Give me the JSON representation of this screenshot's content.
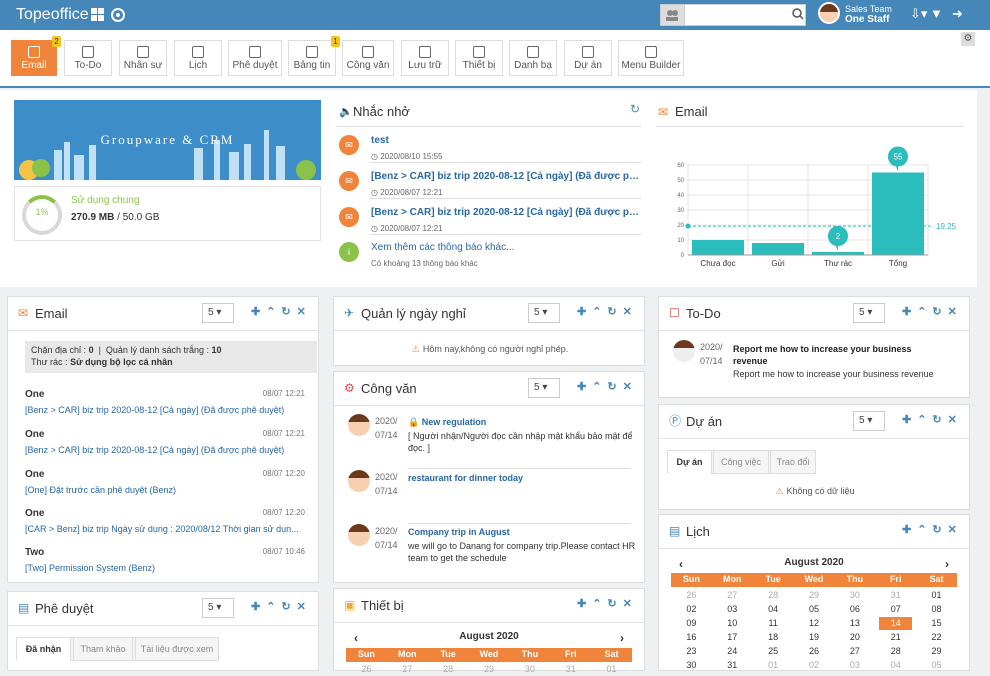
{
  "app": {
    "title": "Topeoffice"
  },
  "header": {
    "user_team": "Sales Team",
    "user_name": "One Staff",
    "search_placeholder": ""
  },
  "toolbar": {
    "modules": [
      {
        "label": "Email",
        "badge": "2",
        "active": true
      },
      {
        "label": "To-Do"
      },
      {
        "label": "Nhân sự"
      },
      {
        "label": "Lịch"
      },
      {
        "label": "Phê duyệt"
      },
      {
        "label": "Bảng tin",
        "badge": "1"
      },
      {
        "label": "Công văn"
      },
      {
        "label": "Lưu trữ"
      },
      {
        "label": "Thiết bị"
      },
      {
        "label": "Danh bạ"
      },
      {
        "label": "Dự án"
      },
      {
        "label": "Menu Builder"
      }
    ]
  },
  "banner": {
    "text": "Groupware & CRM"
  },
  "usage": {
    "title": "Sử dụng chung",
    "percent": "1%",
    "value": "270.9 MB",
    "total": "50.0 GB"
  },
  "reminders": {
    "title": "Nhắc nhở",
    "items": [
      {
        "title": "test",
        "date": "2020/08/10 15:55"
      },
      {
        "title": "[Benz > CAR] biz trip 2020-08-12 [Cả ngày] (Đã được phê...",
        "date": "2020/08/07 12:21"
      },
      {
        "title": "[Benz > CAR] biz trip 2020-08-12 [Cả ngày] (Đã được phê...",
        "date": "2020/08/07 12:21"
      }
    ],
    "more": "Xem thêm các thông báo khác...",
    "more_count": "Có khoảng 13 thông báo khác"
  },
  "email_chart": {
    "title": "Email"
  },
  "chart_data": {
    "type": "bar",
    "categories": [
      "Chưa đọc",
      "Gửi",
      "Thư rác",
      "Tổng"
    ],
    "values": [
      10,
      8,
      2,
      55
    ],
    "avg_line": 19.25,
    "avg_label": "19.25",
    "callouts": [
      {
        "category": "Thư rác",
        "label": "2"
      },
      {
        "category": "Tổng",
        "label": "55"
      }
    ],
    "ylim": [
      0,
      60
    ],
    "yticks": [
      "0",
      "10",
      "20",
      "30",
      "40",
      "50",
      "60"
    ],
    "colors": {
      "bar": "#2bbcbc",
      "line": "#2bbcbc"
    }
  },
  "email_panel": {
    "title": "Email",
    "page_size": "5",
    "filter": {
      "line1_a": "Chặn địa chỉ :",
      "line1_a_val": "0",
      "line1_b": "Quản lý danh sách trắng :",
      "line1_b_val": "10",
      "line2": "Thư rác :",
      "line2_val": "Sử dụng bộ lọc cá nhân"
    },
    "rows": [
      {
        "sender": "One",
        "time": "08/07 12:21",
        "subject": "[Benz > CAR] biz trip 2020-08-12 [Cả ngày] (Đã được phê duyệt)"
      },
      {
        "sender": "One",
        "time": "08/07 12:21",
        "subject": "[Benz > CAR] biz trip 2020-08-12 [Cả ngày] (Đã được phê duyệt)"
      },
      {
        "sender": "One",
        "time": "08/07 12:20",
        "subject": "[One] Đặt trước cần phê duyệt (Benz)"
      },
      {
        "sender": "One",
        "time": "08/07 12:20",
        "subject": "[CAR > Benz] biz trip Ngày sử dụng : 2020/08/12 Thời gian sử dụn..."
      },
      {
        "sender": "Two",
        "time": "08/07 10:46",
        "subject": "[Two] Permission System (Benz)"
      }
    ]
  },
  "approval_panel": {
    "title": "Phê duyệt",
    "page_size": "5",
    "tabs": [
      "Đã nhận",
      "Tham khảo",
      "Tài liệu được xem"
    ]
  },
  "leave_panel": {
    "title": "Quản lý ngày nghỉ",
    "page_size": "5",
    "empty": "Hôm nay,không có người nghỉ phép."
  },
  "doc_panel": {
    "title": "Công văn",
    "page_size": "5",
    "rows": [
      {
        "year": "2020/",
        "day": "07/14",
        "title": "New regulation",
        "body": "[ Người nhận/Người đọc cần nhập mật khẩu bảo mật để đọc. ]",
        "locked": true
      },
      {
        "year": "2020/",
        "day": "07/14",
        "title": "restaurant for dinner today",
        "body": ""
      },
      {
        "year": "2020/",
        "day": "07/14",
        "title": "Company trip in August",
        "body": "we will go to Danang for company trip.Please contact HR team to get the schedule"
      }
    ]
  },
  "device_panel": {
    "title": "Thiết bị",
    "month": "August 2020",
    "days": [
      "Sun",
      "Mon",
      "Tue",
      "Wed",
      "Thu",
      "Fri",
      "Sat"
    ],
    "first_row": [
      "26",
      "27",
      "28",
      "29",
      "30",
      "31",
      "01"
    ]
  },
  "todo_panel": {
    "title": "To-Do",
    "page_size": "5",
    "item": {
      "year": "2020/",
      "day": "07/14",
      "title": "Report me how to increase your business revenue",
      "body": "Report me how to increase your business revenue"
    }
  },
  "project_panel": {
    "title": "Dự án",
    "page_size": "5",
    "tabs": [
      "Dự án",
      "Công việc",
      "Trao đổi"
    ],
    "empty": "Không có dữ liệu"
  },
  "calendar_panel": {
    "title": "Lịch",
    "month": "August 2020",
    "days": [
      "Sun",
      "Mon",
      "Tue",
      "Wed",
      "Thu",
      "Fri",
      "Sat"
    ],
    "weeks": [
      [
        "26",
        "27",
        "28",
        "29",
        "30",
        "31",
        "01"
      ],
      [
        "02",
        "03",
        "04",
        "05",
        "06",
        "07",
        "08"
      ],
      [
        "09",
        "10",
        "11",
        "12",
        "13",
        "14",
        "15"
      ],
      [
        "16",
        "17",
        "18",
        "19",
        "20",
        "21",
        "22"
      ],
      [
        "23",
        "24",
        "25",
        "26",
        "27",
        "28",
        "29"
      ],
      [
        "30",
        "31",
        "01",
        "02",
        "03",
        "04",
        "05"
      ]
    ],
    "today": "14"
  }
}
